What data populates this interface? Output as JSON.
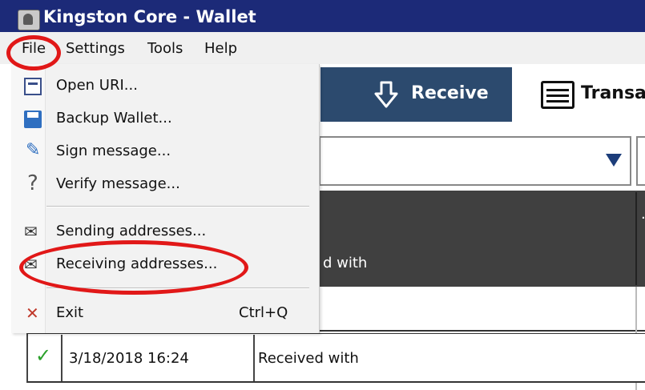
{
  "window": {
    "title": "Kingston Core - Wallet"
  },
  "menubar": {
    "file": "File",
    "settings": "Settings",
    "tools": "Tools",
    "help": "Help"
  },
  "toolbar": {
    "receive": "Receive",
    "transactions": "Transa"
  },
  "table": {
    "header_text": "d with",
    "row": {
      "date": "3/18/2018 16:24",
      "type": "Received with"
    }
  },
  "file_menu": {
    "items": [
      {
        "label": "Open URI...",
        "icon": "open-uri-icon"
      },
      {
        "label": "Backup Wallet...",
        "icon": "save-icon"
      },
      {
        "label": "Sign message...",
        "icon": "sign-pen-icon"
      },
      {
        "label": "Verify message...",
        "icon": "question-mark-icon"
      },
      {
        "label": "Sending addresses...",
        "icon": "address-book-icon"
      },
      {
        "label": "Receiving addresses...",
        "icon": "address-book-icon"
      },
      {
        "label": "Exit",
        "shortcut": "Ctrl+Q",
        "icon": "close-x-icon"
      }
    ]
  },
  "annotation_color": "#e11818"
}
